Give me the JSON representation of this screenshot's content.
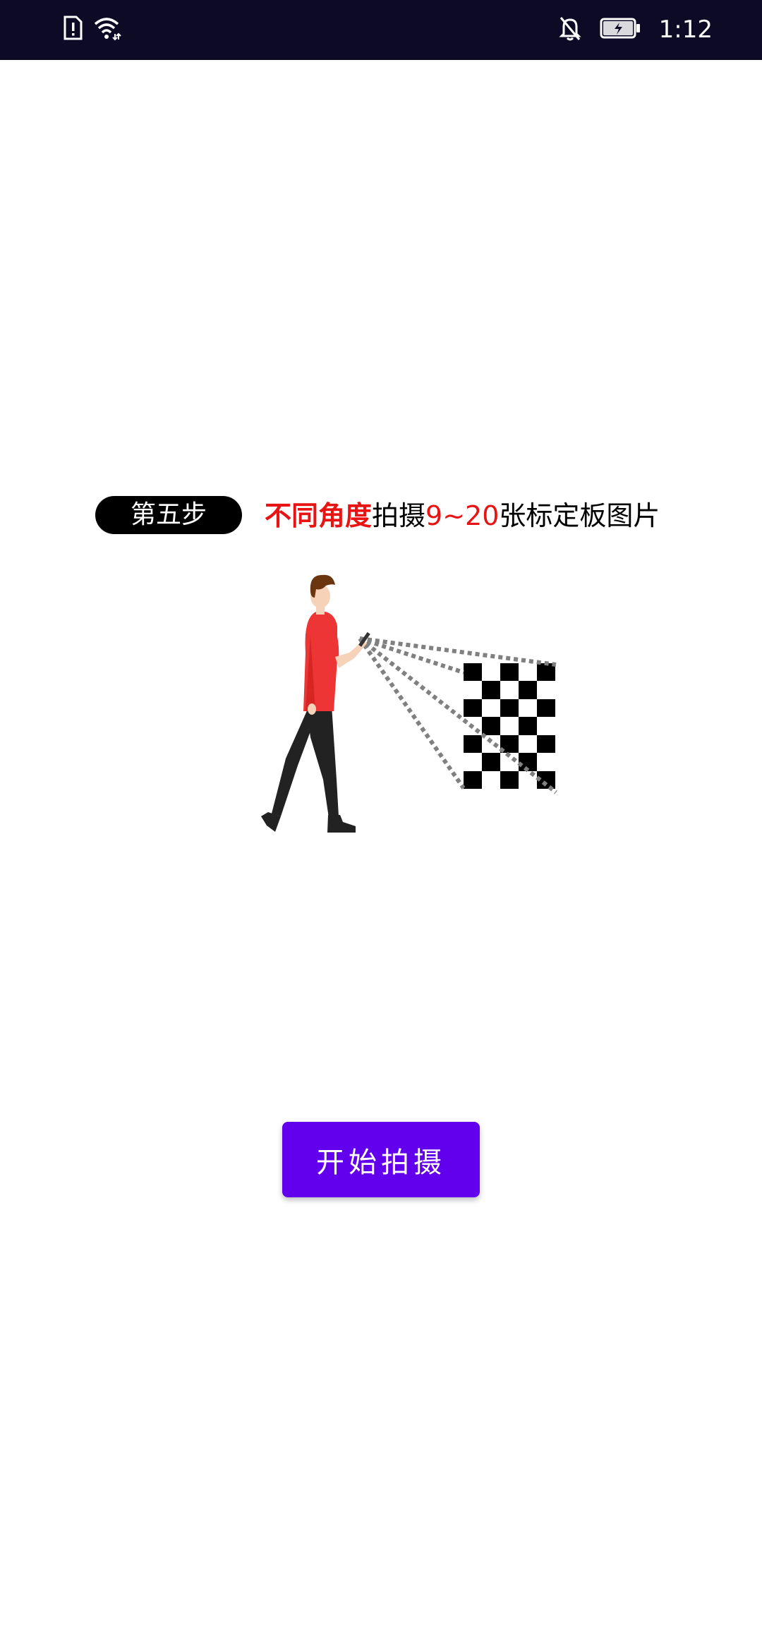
{
  "status_bar": {
    "time": "1:12",
    "icons": [
      "sim-alert-icon",
      "wifi-icon",
      "notifications-off-icon",
      "battery-charging-icon"
    ]
  },
  "step": {
    "badge_label": "第五步",
    "instruction_parts": [
      {
        "text": "不同角度",
        "style": "red-bold"
      },
      {
        "text": "拍摄",
        "style": "normal"
      },
      {
        "text": "9~20",
        "style": "red"
      },
      {
        "text": "张标定板图片",
        "style": "normal"
      }
    ]
  },
  "illustration": {
    "icon": "person-photographing-checkerboard-illustration",
    "colors": {
      "shirt": "#ee3535",
      "pants": "#222222",
      "hair": "#6b3510",
      "skin": "#f6d2b8",
      "rays": "#808080"
    }
  },
  "actions": {
    "start_label": "开始拍摄",
    "accent": "#6200ee"
  }
}
